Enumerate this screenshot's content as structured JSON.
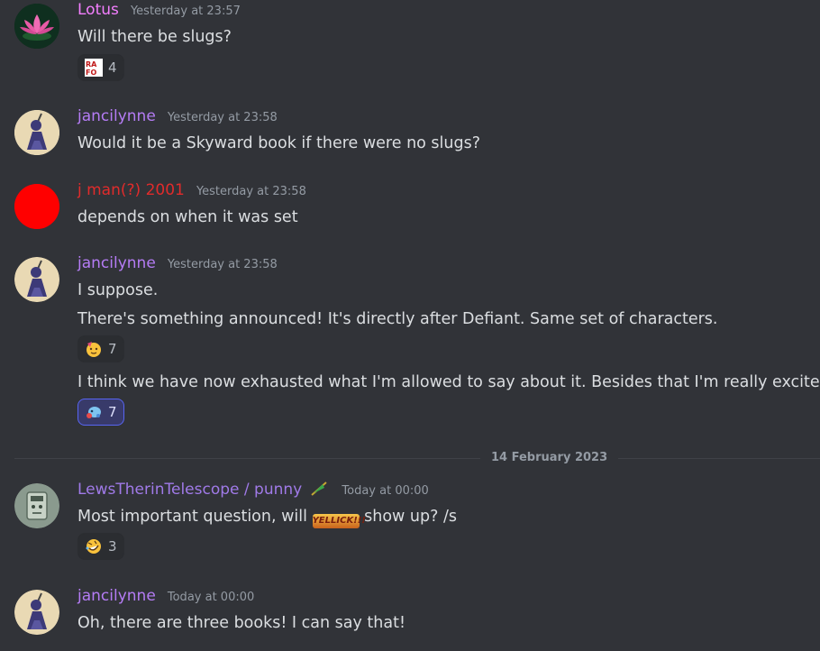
{
  "colors": {
    "lotus": "#f47fff",
    "jancilynne": "#b57cf5",
    "jman": "#e12b2b",
    "lews": "#a07ae8",
    "timestamp": "#949ba4",
    "text": "#dbdee1"
  },
  "messages": [
    {
      "author": "Lotus",
      "timestamp": "Yesterday at 23:57",
      "avatar_icon": "lotus-flower-icon",
      "lines": [
        "Will there be slugs?"
      ],
      "reactions": [
        {
          "emoji": "rafo-emoji",
          "count": "4"
        }
      ]
    },
    {
      "author": "jancilynne",
      "timestamp": "Yesterday at 23:58",
      "avatar_icon": "ninja-avatar",
      "lines": [
        "Would it be a Skyward book if there were no slugs?"
      ]
    },
    {
      "author": "j man(?) 2001",
      "timestamp": "Yesterday at 23:58",
      "avatar_icon": "red-circle-avatar",
      "lines": [
        "depends on when it was set"
      ]
    },
    {
      "author": "jancilynne",
      "timestamp": "Yesterday at 23:58",
      "avatar_icon": "ninja-avatar",
      "lines": [
        "I suppose.",
        "There's something announced!  It's directly after Defiant.  Same set of characters.",
        "I think we have now exhausted what I'm allowed to say about it.  Besides that I'm really excited."
      ],
      "reactions": [
        {
          "emoji": "partying-face-emoji",
          "count": "7"
        },
        {
          "emoji": "custom-blue-emoji",
          "count": "7"
        }
      ]
    },
    {
      "author": "LewsTherinTelescope / punny",
      "timestamp": "Today at 00:00",
      "avatar_icon": "robot-avatar",
      "lines_before": "Most important question, will ",
      "inline_emoji_text": "YELLICK!!!",
      "lines_after": " show up? /s",
      "reactions": [
        {
          "emoji": "rolling-laughing-emoji",
          "count": "3"
        }
      ]
    },
    {
      "author": "jancilynne",
      "timestamp": "Today at 00:00",
      "avatar_icon": "ninja-avatar",
      "lines": [
        "Oh, there are three books!  I can say that!"
      ]
    }
  ],
  "date_divider": "14 February 2023"
}
